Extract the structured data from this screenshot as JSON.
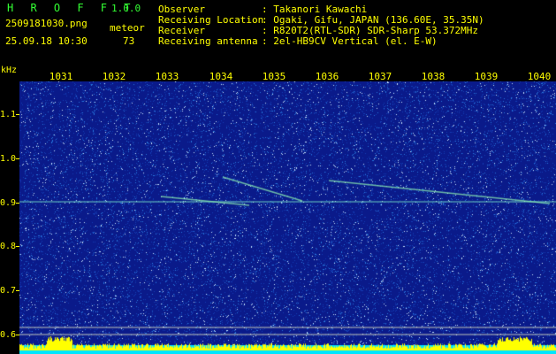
{
  "app": {
    "name": "H R O F F T",
    "version": "1.0.0"
  },
  "file": {
    "name": "2509181030.png",
    "datetime": "25.09.18 10:30"
  },
  "meteor": {
    "label": "meteor",
    "count": "73"
  },
  "info": [
    {
      "key": "Observer",
      "value": ": Takanori Kawachi"
    },
    {
      "key": "Receiving Location",
      "value": ": Ogaki, Gifu, JAPAN (136.60E, 35.35N)"
    },
    {
      "key": "Receiver",
      "value": ": R820T2(RTL-SDR) SDR-Sharp 53.372MHz"
    },
    {
      "key": "Receiving antenna",
      "value": ": 2el-HB9CV Vertical (el. E-W)"
    }
  ],
  "axis": {
    "unit": "kHz",
    "x_ticks": [
      "1031",
      "1032",
      "1033",
      "1034",
      "1035",
      "1036",
      "1037",
      "1038",
      "1039",
      "1040"
    ],
    "y_ticks": [
      "1.1",
      "1.0",
      "0.9",
      "0.8",
      "0.7",
      "0.6"
    ]
  },
  "colors": {
    "background": "#0a1a8a",
    "text": "#ffff00",
    "accent": "#33ff33"
  }
}
